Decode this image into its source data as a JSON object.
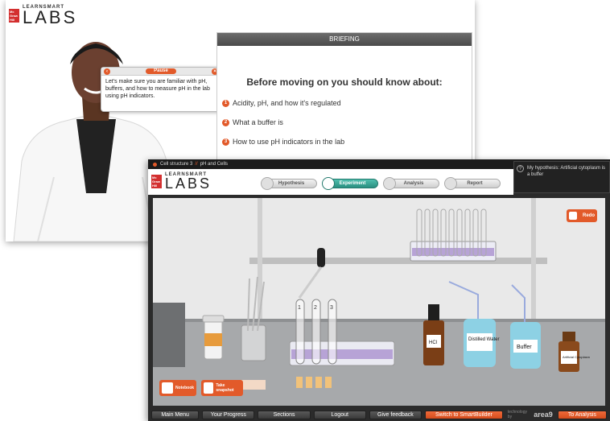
{
  "colors": {
    "accent": "#e25a2a",
    "teal": "#2a8f80",
    "dark": "#2b2b2b"
  },
  "brand": {
    "small": "LEARNSMART",
    "big": "LABS",
    "badge": "Mc Graw Hill"
  },
  "briefing_window": {
    "pause_label": "Pause",
    "dialog_text": "Let's make sure you are familiar with pH, buffers, and how to measure pH in the lab using pH indicators.",
    "header": "BRIEFING",
    "title": "Before moving on you should know about:",
    "items": [
      {
        "num": "1",
        "text": "Acidity, pH, and how it's regulated"
      },
      {
        "num": "2",
        "text": "What a buffer is"
      },
      {
        "num": "3",
        "text": "How to use pH indicators in the lab"
      }
    ]
  },
  "experiment_window": {
    "breadcrumb": {
      "course": "Cell structure 3",
      "topic": "pH and Cells"
    },
    "hypothesis": "My hypothesis: Artificial cytoplasm is a buffer",
    "steps": [
      "Hypothesis",
      "Experiment",
      "Analysis",
      "Report"
    ],
    "active_step": "Experiment",
    "redo_label": "Redo",
    "notebook_label": "Notebook",
    "snapshot_label": "Take snapshot",
    "tube_numbers": [
      "1",
      "2",
      "3"
    ],
    "bottle_labels": {
      "hcl": "HCl",
      "water": "Distilled Water",
      "buffer": "Buffer",
      "cytoplasm": "Artificial Cytoplasm"
    },
    "nav": [
      "Main Menu",
      "Your Progress",
      "Sections",
      "Logout",
      "Give feedback",
      "Switch to SmartBuilder"
    ],
    "powered_by": "technology by",
    "powered_brand": "area9",
    "to_analysis": "To Analysis"
  }
}
